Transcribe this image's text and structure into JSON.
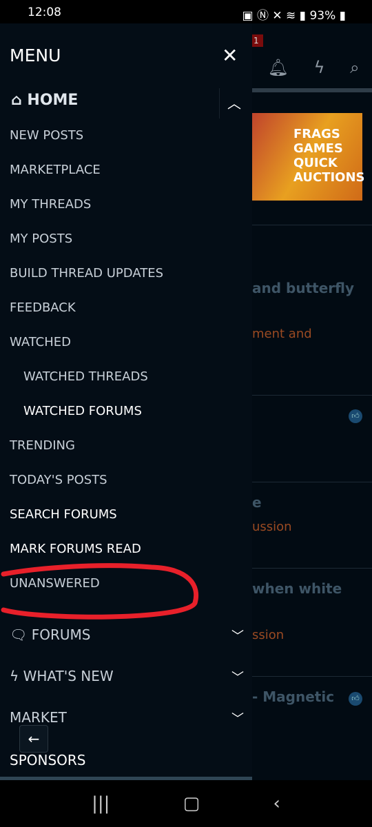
{
  "status": {
    "time": "12:08",
    "battery": "93%"
  },
  "background": {
    "notification_count": "1",
    "fragments": [
      "and butterfly",
      "ment and",
      "e",
      "ussion",
      "when white",
      "ssion",
      "- Magnetic"
    ],
    "banner_text": "FRAGS GAMES QUICK AUCTIONS"
  },
  "menu": {
    "title": "MENU",
    "home": "HOME",
    "items": [
      "NEW POSTS",
      "MARKETPLACE",
      "MY THREADS",
      "MY POSTS",
      "BUILD THREAD UPDATES",
      "FEEDBACK",
      "WATCHED",
      "WATCHED THREADS",
      "WATCHED FORUMS",
      "TRENDING",
      "TODAY'S POSTS",
      "SEARCH FORUMS",
      "MARK FORUMS READ",
      "UNANSWERED"
    ],
    "sections": [
      "FORUMS",
      "WHAT'S NEW",
      "MARKET"
    ],
    "sponsors": "SPONSORS"
  },
  "colors": {
    "accent_orange": "#9a4a22",
    "annotation": "#e8202a"
  }
}
